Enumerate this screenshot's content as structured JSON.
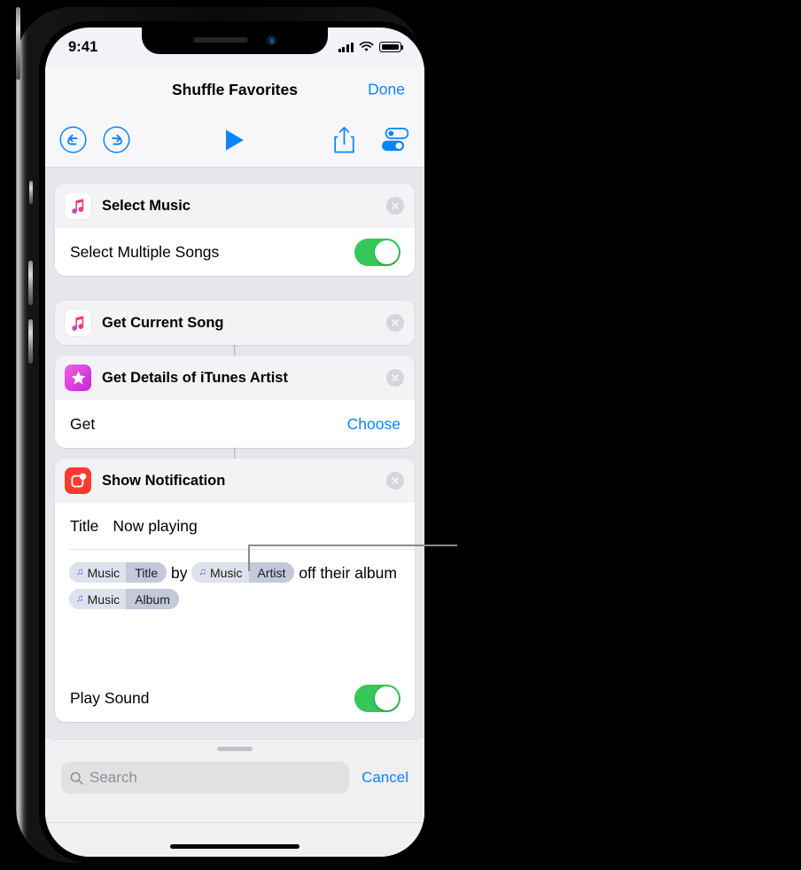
{
  "status_bar": {
    "time": "9:41",
    "signal_icon": "cellular-signal-icon",
    "wifi_icon": "wifi-icon",
    "battery_icon": "battery-full-icon"
  },
  "nav_bar": {
    "title": "Shuffle Favorites",
    "done_label": "Done"
  },
  "toolbar": {
    "undo_icon": "undo-icon",
    "redo_icon": "redo-icon",
    "play_icon": "play-icon",
    "share_icon": "share-icon",
    "settings_icon": "settings-toggles-icon"
  },
  "actions": [
    {
      "title": "Select Music",
      "icon": "apple-music-icon",
      "rows": [
        {
          "label": "Select Multiple Songs",
          "control": "toggle",
          "value": "on"
        }
      ]
    },
    {
      "title": "Get Current Song",
      "icon": "apple-music-icon",
      "rows": []
    },
    {
      "title": "Get Details of iTunes Artist",
      "icon": "itunes-store-star-icon",
      "rows": [
        {
          "label": "Get",
          "control": "link",
          "value": "Choose"
        }
      ]
    },
    {
      "title": "Show Notification",
      "icon": "show-notification-icon",
      "rows": [
        {
          "label": "Play Sound",
          "control": "toggle",
          "value": "on"
        }
      ]
    }
  ],
  "notification": {
    "title_label": "Title",
    "title_value": "Now playing",
    "body": {
      "word_by": "by",
      "text_off_their": "off their",
      "word_album": "album",
      "tokens": [
        {
          "app": "Music",
          "field": "Title"
        },
        {
          "app": "Music",
          "field": "Artist"
        },
        {
          "app": "Music",
          "field": "Album"
        }
      ]
    }
  },
  "search": {
    "placeholder": "Search",
    "cancel_label": "Cancel",
    "search_icon": "search-icon"
  },
  "colors": {
    "accent_blue": "#0a84ff",
    "toggle_green": "#34c759",
    "notification_red": "#ff3b30",
    "itunes_magenta": "#e040c0",
    "token_bg": "#dfe2ec",
    "screen_bg": "#e6e7eb"
  }
}
